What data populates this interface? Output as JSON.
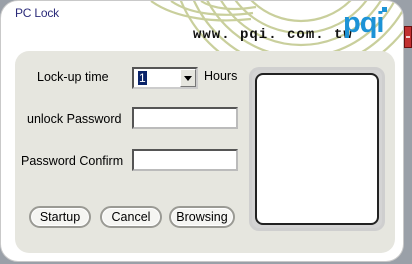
{
  "window": {
    "title": "PC Lock"
  },
  "header": {
    "url": "www. pqi. com. tw",
    "logo": "pqi"
  },
  "form": {
    "lockup_label": "Lock-up time",
    "lockup_value": "1",
    "lockup_unit": "Hours",
    "unlock_label": "unlock Password",
    "unlock_value": "",
    "confirm_label": "Password Confirm",
    "confirm_value": ""
  },
  "buttons": {
    "startup": "Startup",
    "cancel": "Cancel",
    "browsing": "Browsing"
  },
  "colors": {
    "brand": "#1d93d6",
    "title_text": "#2b2b7a",
    "swirl": "#c9cf9c"
  }
}
